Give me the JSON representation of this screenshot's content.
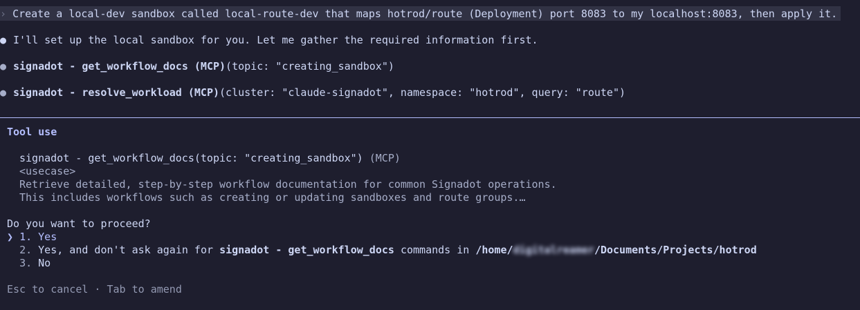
{
  "prompt": {
    "chevron": "›",
    "text": "Create a local-dev sandbox called local-route-dev that maps hotrod/route (Deployment) port 8083 to my localhost:8083, then apply it."
  },
  "messages": [
    {
      "bullet": "●",
      "text": "I'll set up the local sandbox for you. Let me gather the required information first."
    },
    {
      "bullet": "●",
      "tool": "signadot - get_workflow_docs (MCP)",
      "args": "(topic: \"creating_sandbox\")"
    },
    {
      "bullet": "●",
      "tool": "signadot - resolve_workload (MCP)",
      "args": "(cluster: \"claude-signadot\", namespace: \"hotrod\", query: \"route\")"
    }
  ],
  "tool_use": {
    "title": "Tool use",
    "call": "signadot - get_workflow_docs(topic: \"creating_sandbox\")",
    "call_suffix": "(MCP)",
    "description_lines": [
      "<usecase>",
      "Retrieve detailed, step-by-step workflow documentation for common Signadot operations.",
      "This includes workflows such as creating or updating sandboxes and route groups.…"
    ]
  },
  "question": "Do you want to proceed?",
  "options": [
    {
      "marker": "❯",
      "number": "1.",
      "label": "Yes",
      "selected": true
    },
    {
      "marker": " ",
      "number": "2.",
      "label_prefix": "Yes, and don't ask again for ",
      "label_bold": "signadot - get_workflow_docs",
      "label_mid": " commands in ",
      "path_start": "/home/",
      "path_redacted": "digitalreamer",
      "path_end": "/Documents/Projects/hotrod",
      "selected": false
    },
    {
      "marker": " ",
      "number": "3.",
      "label": "No",
      "selected": false
    }
  ],
  "help_text": "Esc to cancel · Tab to amend",
  "colors": {
    "background": "#1e1e2e",
    "accent": "#b4befe",
    "text": "#cdd6f4",
    "dim": "#a6adc8"
  }
}
